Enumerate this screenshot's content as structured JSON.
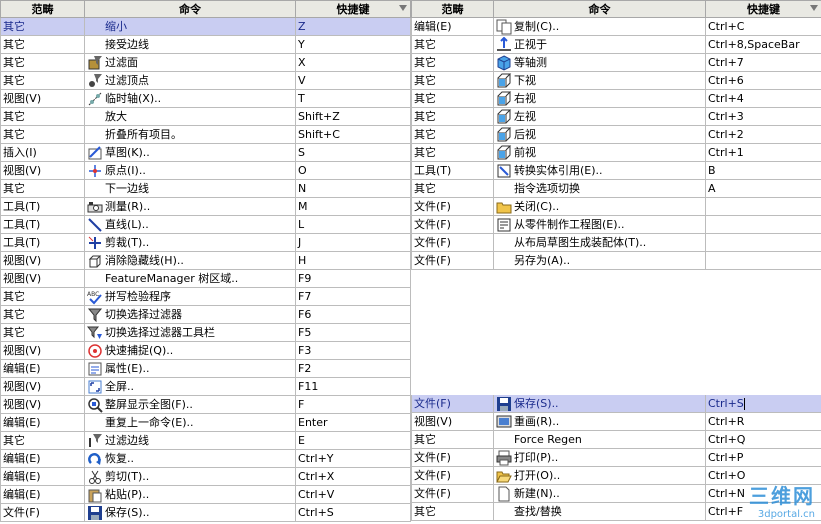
{
  "headers": {
    "category": "范畴",
    "command": "命令",
    "shortcut": "快捷键"
  },
  "left_rows": [
    {
      "cat": "其它",
      "cmd": "缩小",
      "key": "Z",
      "icon": "blank",
      "selected": true
    },
    {
      "cat": "其它",
      "cmd": "接受边线",
      "key": "Y",
      "icon": "blank"
    },
    {
      "cat": "其它",
      "cmd": "过滤面",
      "key": "X",
      "icon": "filter-face-icon"
    },
    {
      "cat": "其它",
      "cmd": "过滤顶点",
      "key": "V",
      "icon": "filter-vertex-icon"
    },
    {
      "cat": "视图(V)",
      "cmd": "临时轴(X)..",
      "key": "T",
      "icon": "temporary-axis-icon"
    },
    {
      "cat": "其它",
      "cmd": "放大",
      "key": "Shift+Z",
      "icon": "blank"
    },
    {
      "cat": "其它",
      "cmd": "折叠所有项目。",
      "key": "Shift+C",
      "icon": "blank"
    },
    {
      "cat": "插入(I)",
      "cmd": "草图(K)..",
      "key": "S",
      "icon": "sketch-icon"
    },
    {
      "cat": "视图(V)",
      "cmd": "原点(I)..",
      "key": "O",
      "icon": "origin-icon"
    },
    {
      "cat": "其它",
      "cmd": "下一边线",
      "key": "N",
      "icon": "blank"
    },
    {
      "cat": "工具(T)",
      "cmd": "测量(R)..",
      "key": "M",
      "icon": "measure-icon"
    },
    {
      "cat": "工具(T)",
      "cmd": "直线(L)..",
      "key": "L",
      "icon": "line-icon"
    },
    {
      "cat": "工具(T)",
      "cmd": "剪裁(T)..",
      "key": "J",
      "icon": "trim-icon"
    },
    {
      "cat": "视图(V)",
      "cmd": "消除隐藏线(H)..",
      "key": "H",
      "icon": "hidden-lines-removed-icon"
    },
    {
      "cat": "视图(V)",
      "cmd": "FeatureManager 树区域..",
      "key": "F9",
      "icon": "blank"
    },
    {
      "cat": "其它",
      "cmd": "拼写检验程序",
      "key": "F7",
      "icon": "spell-check-icon"
    },
    {
      "cat": "其它",
      "cmd": "切换选择过滤器",
      "key": "F6",
      "icon": "selection-filter-icon"
    },
    {
      "cat": "其它",
      "cmd": "切换选择过滤器工具栏",
      "key": "F5",
      "icon": "selection-filter-toolbar-icon"
    },
    {
      "cat": "视图(V)",
      "cmd": "快速捕捉(Q)..",
      "key": "F3",
      "icon": "quick-snap-icon"
    },
    {
      "cat": "编辑(E)",
      "cmd": "属性(E)..",
      "key": "F2",
      "icon": "properties-icon"
    },
    {
      "cat": "视图(V)",
      "cmd": "全屏..",
      "key": "F11",
      "icon": "full-screen-icon"
    },
    {
      "cat": "视图(V)",
      "cmd": "整屏显示全图(F)..",
      "key": "F",
      "icon": "zoom-to-fit-icon"
    },
    {
      "cat": "编辑(E)",
      "cmd": "重复上一命令(E)..",
      "key": "Enter",
      "icon": "blank"
    },
    {
      "cat": "其它",
      "cmd": "过滤边线",
      "key": "E",
      "icon": "filter-edge-icon"
    },
    {
      "cat": "编辑(E)",
      "cmd": "恢复..",
      "key": "Ctrl+Y",
      "icon": "redo-icon"
    },
    {
      "cat": "编辑(E)",
      "cmd": "剪切(T)..",
      "key": "Ctrl+X",
      "icon": "cut-icon"
    },
    {
      "cat": "编辑(E)",
      "cmd": "粘贴(P)..",
      "key": "Ctrl+V",
      "icon": "paste-icon"
    },
    {
      "cat": "文件(F)",
      "cmd": "保存(S)..",
      "key": "Ctrl+S",
      "icon": "save-icon"
    }
  ],
  "right_rows_top": [
    {
      "cat": "编辑(E)",
      "cmd": "复制(C)..",
      "key": "Ctrl+C",
      "icon": "copy-icon"
    },
    {
      "cat": "其它",
      "cmd": "正视于",
      "key": "Ctrl+8,SpaceBar",
      "icon": "normal-to-icon"
    },
    {
      "cat": "其它",
      "cmd": "等轴测",
      "key": "Ctrl+7",
      "icon": "isometric-icon"
    },
    {
      "cat": "其它",
      "cmd": "下视",
      "key": "Ctrl+6",
      "icon": "bottom-view-icon"
    },
    {
      "cat": "其它",
      "cmd": "右视",
      "key": "Ctrl+4",
      "icon": "right-view-icon"
    },
    {
      "cat": "其它",
      "cmd": "左视",
      "key": "Ctrl+3",
      "icon": "left-view-icon"
    },
    {
      "cat": "其它",
      "cmd": "后视",
      "key": "Ctrl+2",
      "icon": "back-view-icon"
    },
    {
      "cat": "其它",
      "cmd": "前视",
      "key": "Ctrl+1",
      "icon": "front-view-icon"
    },
    {
      "cat": "工具(T)",
      "cmd": "转换实体引用(E)..",
      "key": "B",
      "icon": "convert-entities-icon"
    },
    {
      "cat": "其它",
      "cmd": "指令选项切换",
      "key": "A",
      "icon": "blank"
    },
    {
      "cat": "文件(F)",
      "cmd": "关闭(C)..",
      "key": "",
      "icon": "close-folder-icon"
    },
    {
      "cat": "文件(F)",
      "cmd": "从零件制作工程图(E)..",
      "key": "",
      "icon": "make-drawing-icon"
    },
    {
      "cat": "文件(F)",
      "cmd": "从布局草图生成装配体(T)..",
      "key": "",
      "icon": "blank"
    },
    {
      "cat": "文件(F)",
      "cmd": "另存为(A)..",
      "key": "",
      "icon": "blank"
    }
  ],
  "right_rows_bottom": [
    {
      "cat": "文件(F)",
      "cmd": "保存(S)..",
      "key": "Ctrl+S",
      "icon": "save-icon",
      "selected": true
    },
    {
      "cat": "视图(V)",
      "cmd": "重画(R)..",
      "key": "Ctrl+R",
      "icon": "redraw-icon"
    },
    {
      "cat": "其它",
      "cmd": "Force Regen",
      "key": "Ctrl+Q",
      "icon": "blank"
    },
    {
      "cat": "文件(F)",
      "cmd": "打印(P)..",
      "key": "Ctrl+P",
      "icon": "print-icon"
    },
    {
      "cat": "文件(F)",
      "cmd": "打开(O)..",
      "key": "Ctrl+O",
      "icon": "open-icon"
    },
    {
      "cat": "文件(F)",
      "cmd": "新建(N)..",
      "key": "Ctrl+N",
      "icon": "new-document-icon"
    },
    {
      "cat": "其它",
      "cmd": "查找/替换",
      "key": "Ctrl+F",
      "icon": "blank"
    }
  ],
  "watermark": {
    "brand": "三维网",
    "url": "3dportal.cn"
  }
}
